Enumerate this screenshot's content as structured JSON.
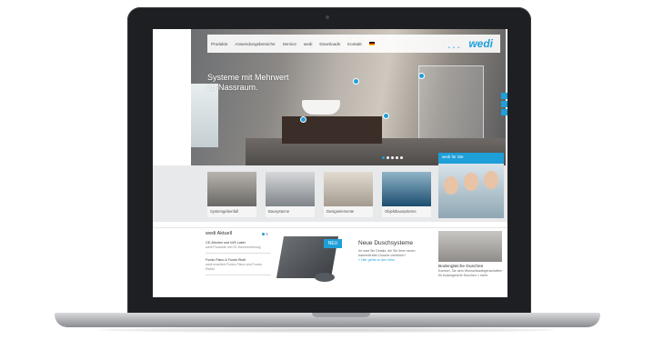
{
  "nav": {
    "items": [
      "Produkte",
      "Anwendungsbereiche",
      "Service",
      "wedi",
      "Downloads",
      "Kontakt"
    ],
    "logo": "wedi",
    "logo_dots": "• • •"
  },
  "hero": {
    "title": "Systeme mit Mehrwert\nim Nassraum."
  },
  "promo": {
    "label": "wedi für Sie"
  },
  "categories": [
    {
      "label": "Systemgebenfall"
    },
    {
      "label": "Bausysteme"
    },
    {
      "label": "Designelemente"
    },
    {
      "label": "Objektbausysteme"
    }
  ],
  "news": {
    "title": "wedi Aktuell",
    "items": [
      {
        "title": "CE-Zeichen und VdS Label",
        "sub": "wedi Produkte mit CE-Kennzeichnung"
      },
      {
        "title": "Fundo Plano & Fundo Riolit",
        "sub": "wedi erweitert Fundo Plano und Fundo Riolito"
      }
    ]
  },
  "product": {
    "badge": "NEU",
    "title": "Neue Duschsysteme",
    "text": "Ihr wart Sie Details, die Sie Ihrer neuen barrierefreien Dusche verleihen?",
    "link": "» Hier gehts zu den Infos"
  },
  "feature": {
    "title": "Bodengleiche Duschen",
    "text": "Komfort, Sie dem Wunschbadeigenschaften für bodengleiche Duschen » mehr"
  },
  "colors": {
    "accent": "#1f9fd8",
    "laptop_frame": "#1e1f22"
  }
}
